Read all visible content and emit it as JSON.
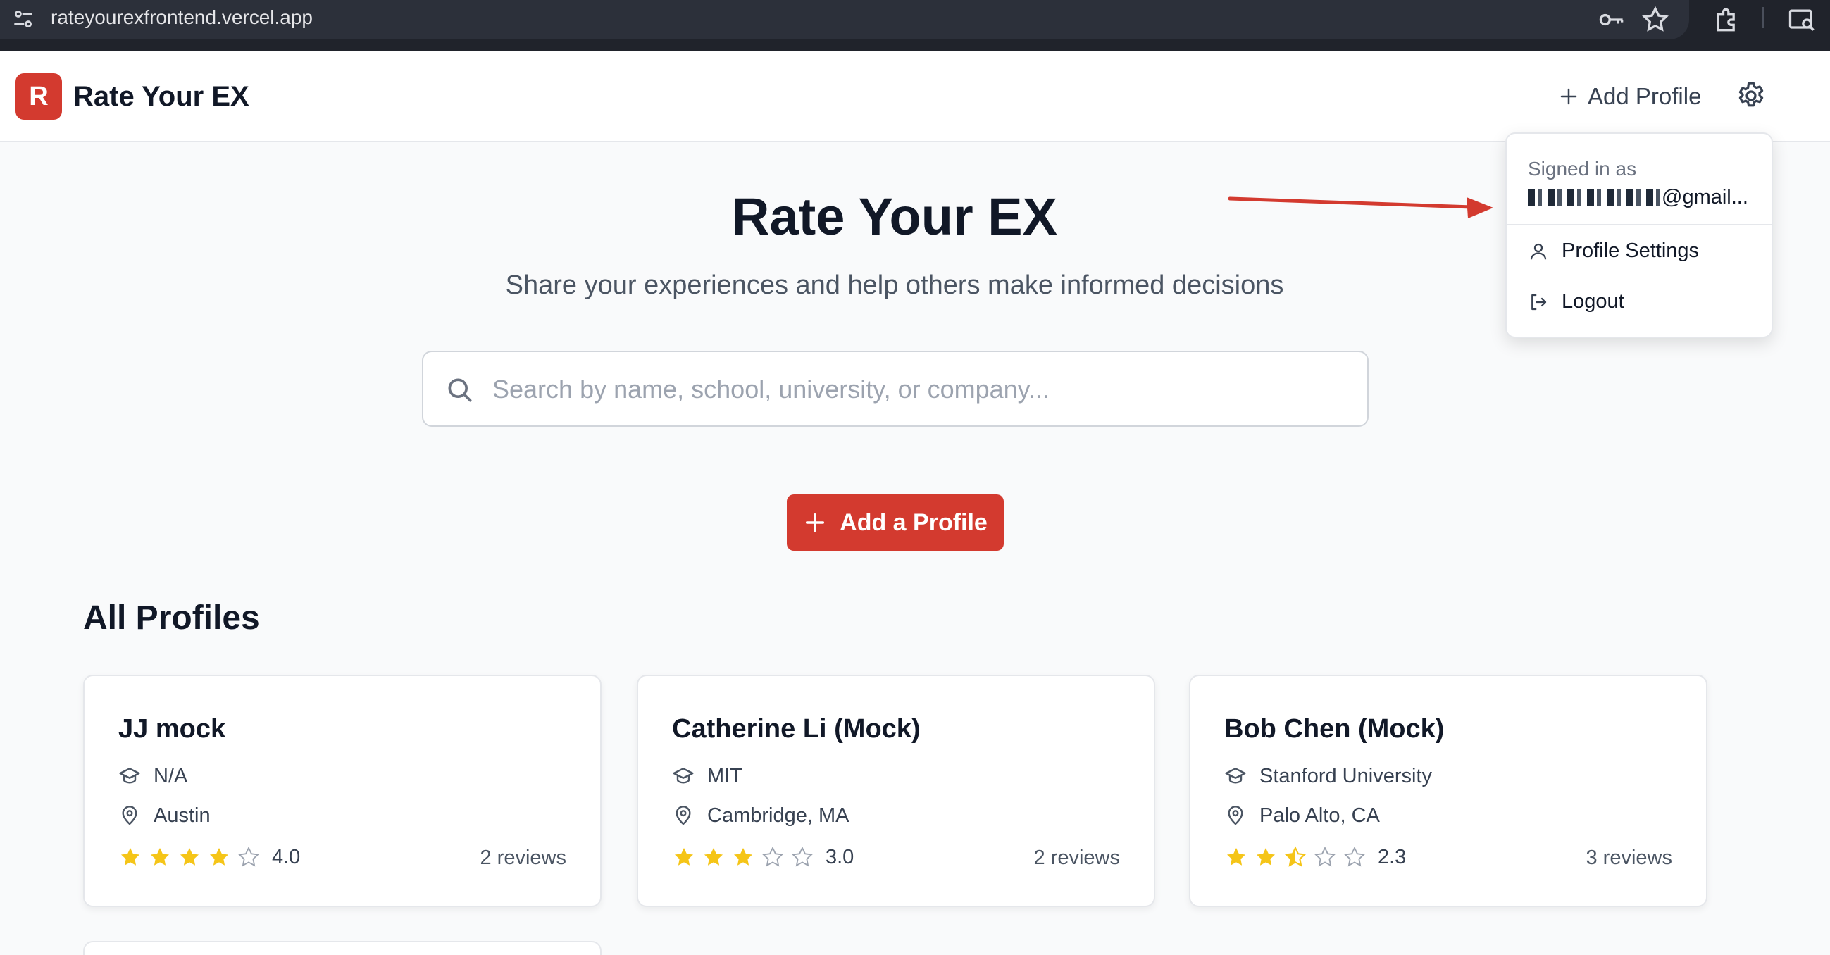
{
  "browser": {
    "url": "rateyourexfrontend.vercel.app",
    "icons": [
      "site-info-icon",
      "key-icon",
      "bookmark-star-icon",
      "extensions-icon",
      "reader-mode-icon"
    ]
  },
  "header": {
    "logo_letter": "R",
    "title": "Rate Your EX",
    "add_profile_label": "Add Profile",
    "settings_icon": "gear-icon"
  },
  "hero": {
    "title": "Rate Your EX",
    "subtitle": "Share your experiences and help others make informed decisions"
  },
  "search": {
    "placeholder": "Search by name, school, university, or company...",
    "value": ""
  },
  "add_button_label": "Add a Profile",
  "section_title": "All Profiles",
  "profiles": [
    {
      "name": "JJ mock",
      "school": "N/A",
      "location": "Austin",
      "rating": 4.0,
      "rating_text": "4.0",
      "reviews": "2 reviews"
    },
    {
      "name": "Catherine Li (Mock)",
      "school": "MIT",
      "location": "Cambridge, MA",
      "rating": 3.0,
      "rating_text": "3.0",
      "reviews": "2 reviews"
    },
    {
      "name": "Bob Chen (Mock)",
      "school": "Stanford University",
      "location": "Palo Alto, CA",
      "rating": 2.3,
      "rating_text": "2.3",
      "reviews": "3 reviews"
    }
  ],
  "account_menu": {
    "signed_in_label": "Signed in as",
    "email_visible": "@gmail...",
    "items": [
      {
        "label": "Profile Settings",
        "icon": "user-icon"
      },
      {
        "label": "Logout",
        "icon": "logout-icon"
      }
    ]
  },
  "colors": {
    "brand": "#d33a2f",
    "star_filled": "#f5c518",
    "star_empty": "#9ca3af",
    "annotation_arrow": "#d33a2f"
  }
}
